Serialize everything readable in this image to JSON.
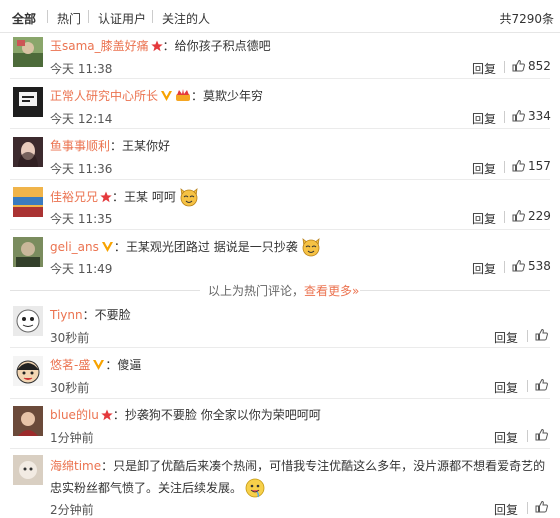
{
  "filters": {
    "all": "全部",
    "hot": "热门",
    "verified": "认证用户",
    "following": "关注的人",
    "total": "共7290条"
  },
  "reply_label": "回复",
  "hot_note": {
    "text": "以上为热门评论，",
    "more": "查看更多»"
  },
  "comments": [
    {
      "user": "玉sama_膝盖好痛",
      "text": "：给你孩子积点德吧",
      "time": "今天 11:38",
      "likes": "852"
    },
    {
      "user": "正常人研究中心所长",
      "text": "：莫欺少年穷",
      "time": "今天 12:14",
      "likes": "334"
    },
    {
      "user": "鱼事事顺利",
      "text": "：王某你好",
      "time": "今天 11:36",
      "likes": "157"
    },
    {
      "user": "佳裕兄兄",
      "text": "：王某 呵呵",
      "time": "今天 11:35",
      "likes": "229"
    },
    {
      "user": "geli_ans",
      "text": "：王某观光团路过 据说是一只抄袭",
      "time": "今天 11:49",
      "likes": "538"
    },
    {
      "user": "Tiynn",
      "text": "：不要脸",
      "time": "30秒前"
    },
    {
      "user": "悠茗-盛",
      "text": "：傻逼",
      "time": "30秒前"
    },
    {
      "user": "blue的lu",
      "text": "：抄袭狗不要脸 你全家以你为荣吧呵呵",
      "time": "1分钟前"
    },
    {
      "user": "海绵time",
      "text": "：只是卸了优酷后来凑个热闹，可惜我专注优酷这么多年，没片源都不想看爱奇艺的忠实粉丝都气愤了。关注后续发展。",
      "time": "2分钟前"
    }
  ],
  "colors": {
    "username": "#eb7350",
    "verified_badge": "#f7a300",
    "star_badge": "#e4393c"
  }
}
